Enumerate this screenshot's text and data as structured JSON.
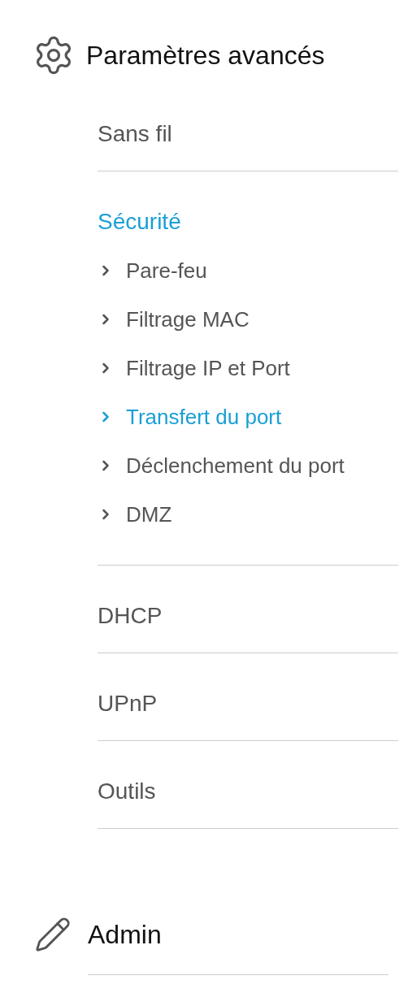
{
  "sections": [
    {
      "kind": "gear",
      "title": "Paramètres avancés",
      "items": [
        {
          "label": "Sans fil",
          "selected": false
        },
        {
          "label": "Sécurité",
          "selected": true,
          "children": [
            {
              "label": "Pare-feu",
              "selected": false
            },
            {
              "label": "Filtrage MAC",
              "selected": false
            },
            {
              "label": "Filtrage IP et Port",
              "selected": false
            },
            {
              "label": "Transfert du port",
              "selected": true
            },
            {
              "label": "Déclenchement du port",
              "selected": false
            },
            {
              "label": "DMZ",
              "selected": false
            }
          ]
        },
        {
          "label": "DHCP",
          "selected": false
        },
        {
          "label": "UPnP",
          "selected": false
        },
        {
          "label": "Outils",
          "selected": false
        }
      ]
    },
    {
      "kind": "pencil",
      "title": "Admin"
    }
  ]
}
